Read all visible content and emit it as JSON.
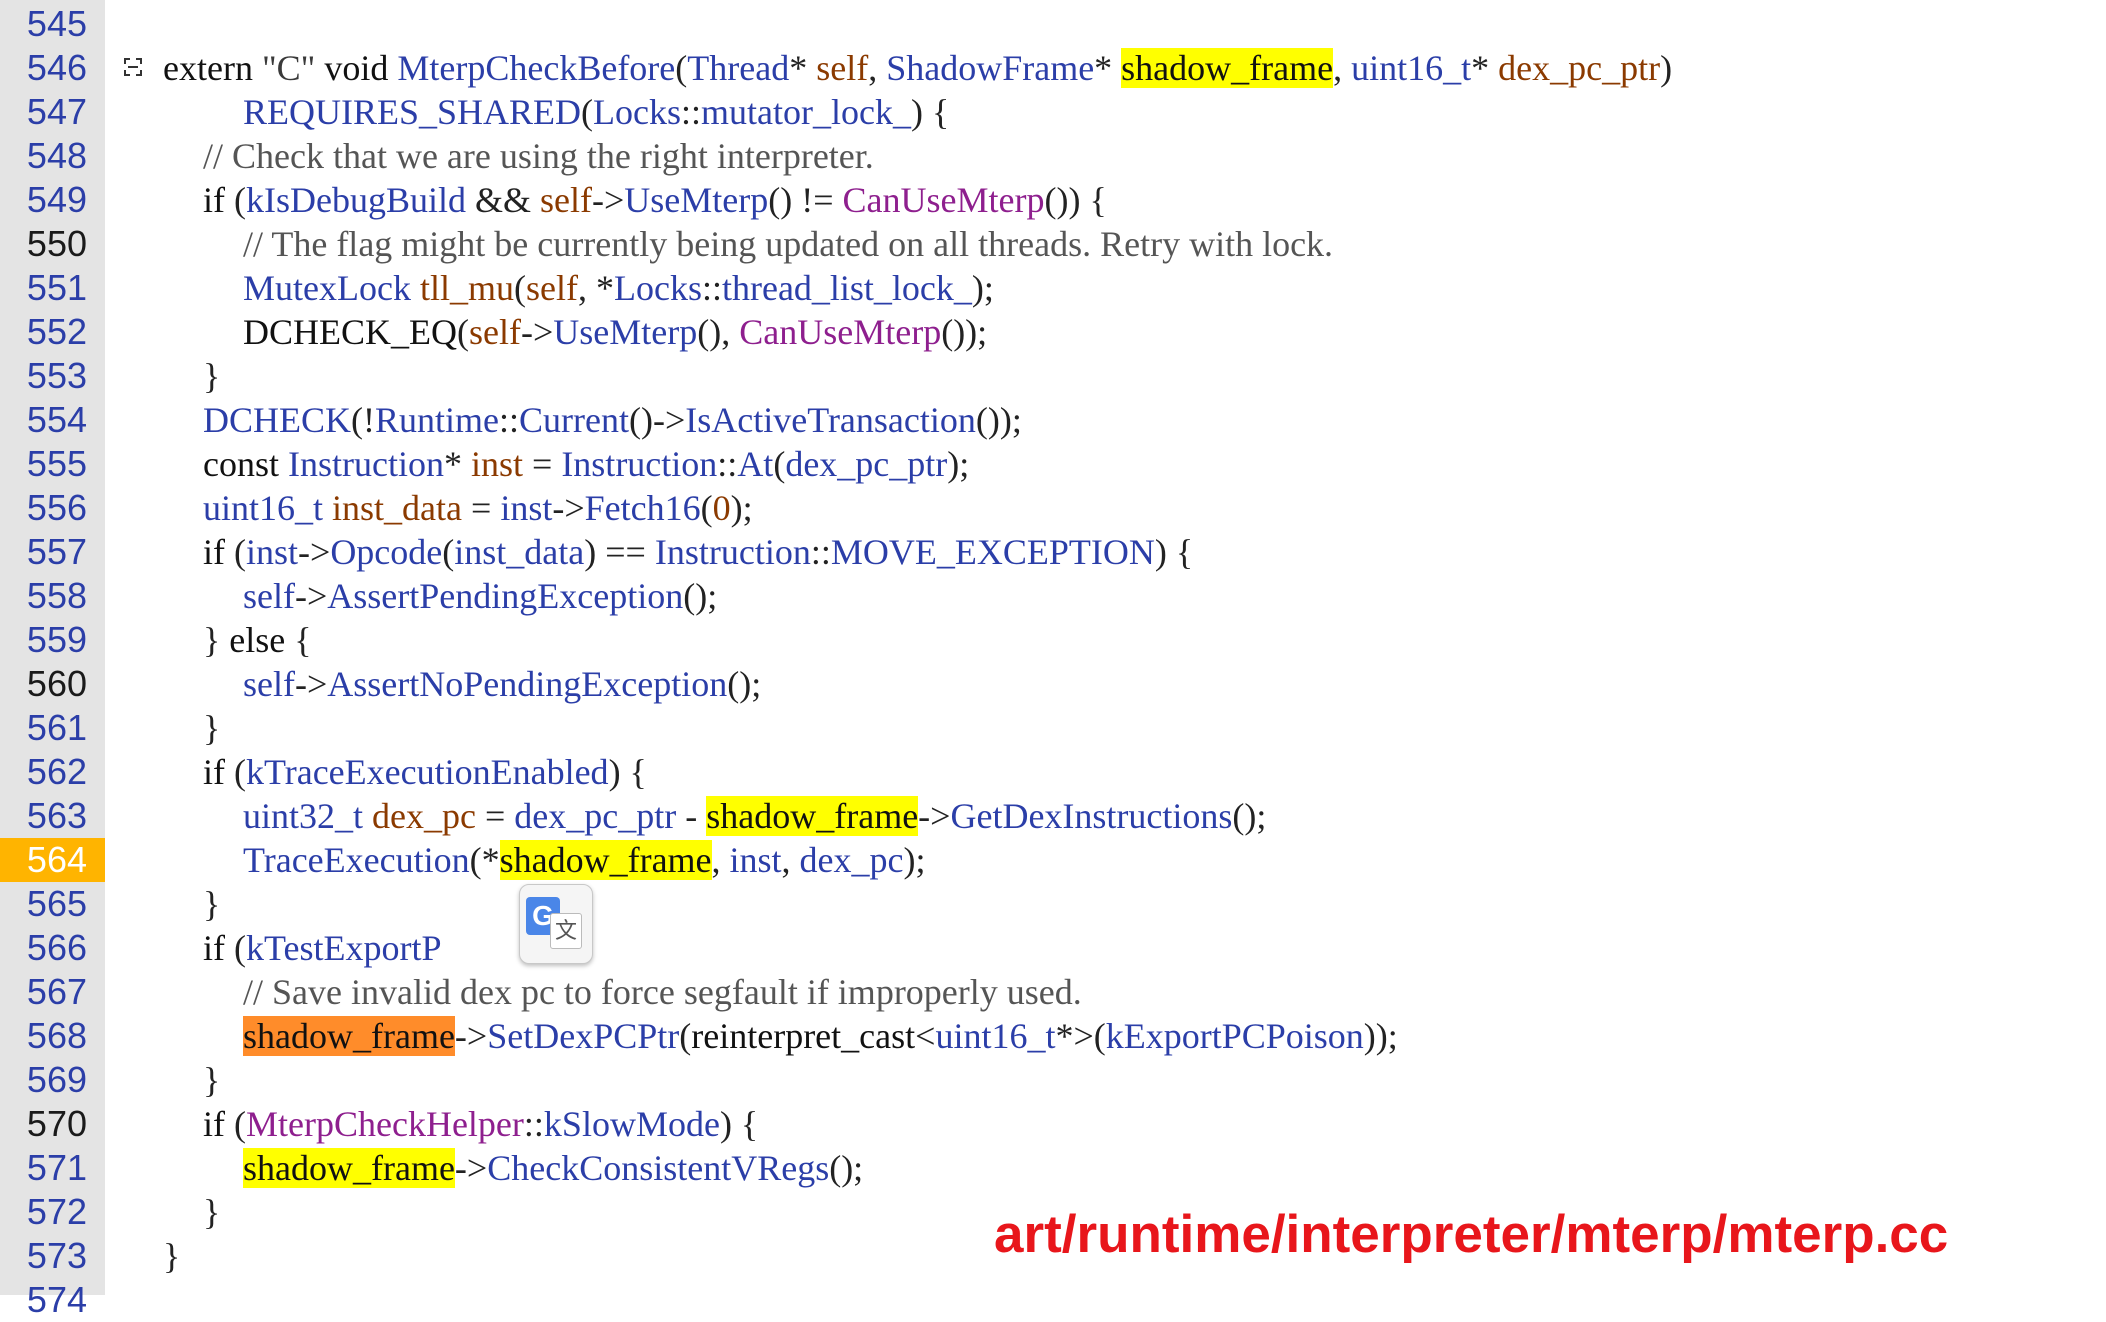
{
  "editor": {
    "current_line": "564",
    "lines": [
      {
        "num": "545",
        "text": ""
      },
      {
        "num": "546",
        "text": "extern \"C\" void MterpCheckBefore(Thread* self, ShadowFrame* shadow_frame, uint16_t* dex_pc_ptr)"
      },
      {
        "num": "547",
        "text": "    REQUIRES_SHARED(Locks::mutator_lock_) {"
      },
      {
        "num": "548",
        "text": "  // Check that we are using the right interpreter."
      },
      {
        "num": "549",
        "text": "  if (kIsDebugBuild && self->UseMterp() != CanUseMterp()) {"
      },
      {
        "num": "550",
        "text": "    // The flag might be currently being updated on all threads. Retry with lock."
      },
      {
        "num": "551",
        "text": "    MutexLock tll_mu(self, *Locks::thread_list_lock_);"
      },
      {
        "num": "552",
        "text": "    DCHECK_EQ(self->UseMterp(), CanUseMterp());"
      },
      {
        "num": "553",
        "text": "  }"
      },
      {
        "num": "554",
        "text": "  DCHECK(!Runtime::Current()->IsActiveTransaction());"
      },
      {
        "num": "555",
        "text": "  const Instruction* inst = Instruction::At(dex_pc_ptr);"
      },
      {
        "num": "556",
        "text": "  uint16_t inst_data = inst->Fetch16(0);"
      },
      {
        "num": "557",
        "text": "  if (inst->Opcode(inst_data) == Instruction::MOVE_EXCEPTION) {"
      },
      {
        "num": "558",
        "text": "    self->AssertPendingException();"
      },
      {
        "num": "559",
        "text": "  } else {"
      },
      {
        "num": "560",
        "text": "    self->AssertNoPendingException();"
      },
      {
        "num": "561",
        "text": "  }"
      },
      {
        "num": "562",
        "text": "  if (kTraceExecutionEnabled) {"
      },
      {
        "num": "563",
        "text": "    uint32_t dex_pc = dex_pc_ptr - shadow_frame->GetDexInstructions();"
      },
      {
        "num": "564",
        "text": "    TraceExecution(*shadow_frame, inst, dex_pc);"
      },
      {
        "num": "565",
        "text": "  }"
      },
      {
        "num": "566",
        "text": "  if (kTestExportP"
      },
      {
        "num": "567",
        "text": "    // Save invalid dex pc to force segfault if improperly used."
      },
      {
        "num": "568",
        "text": "    shadow_frame->SetDexPCPtr(reinterpret_cast<uint16_t*>(kExportPCPoison));"
      },
      {
        "num": "569",
        "text": "  }"
      },
      {
        "num": "570",
        "text": "  if (MterpCheckHelper::kSlowMode) {"
      },
      {
        "num": "571",
        "text": "    shadow_frame->CheckConsistentVRegs();"
      },
      {
        "num": "572",
        "text": "  }"
      },
      {
        "num": "573",
        "text": "}"
      },
      {
        "num": "574",
        "text": ""
      }
    ]
  },
  "overlay": {
    "translate_icon": "google-translate-icon",
    "translate_g": "G",
    "translate_x": "文"
  },
  "annotation": {
    "file_path": "art/runtime/interpreter/mterp/mterp.cc",
    "color": "#e8161b"
  },
  "colors": {
    "highlight": "#ffff00",
    "highlight_current": "#ff8c2a",
    "current_line_marker": "#ffb400",
    "gutter": "#e4e4e4"
  }
}
